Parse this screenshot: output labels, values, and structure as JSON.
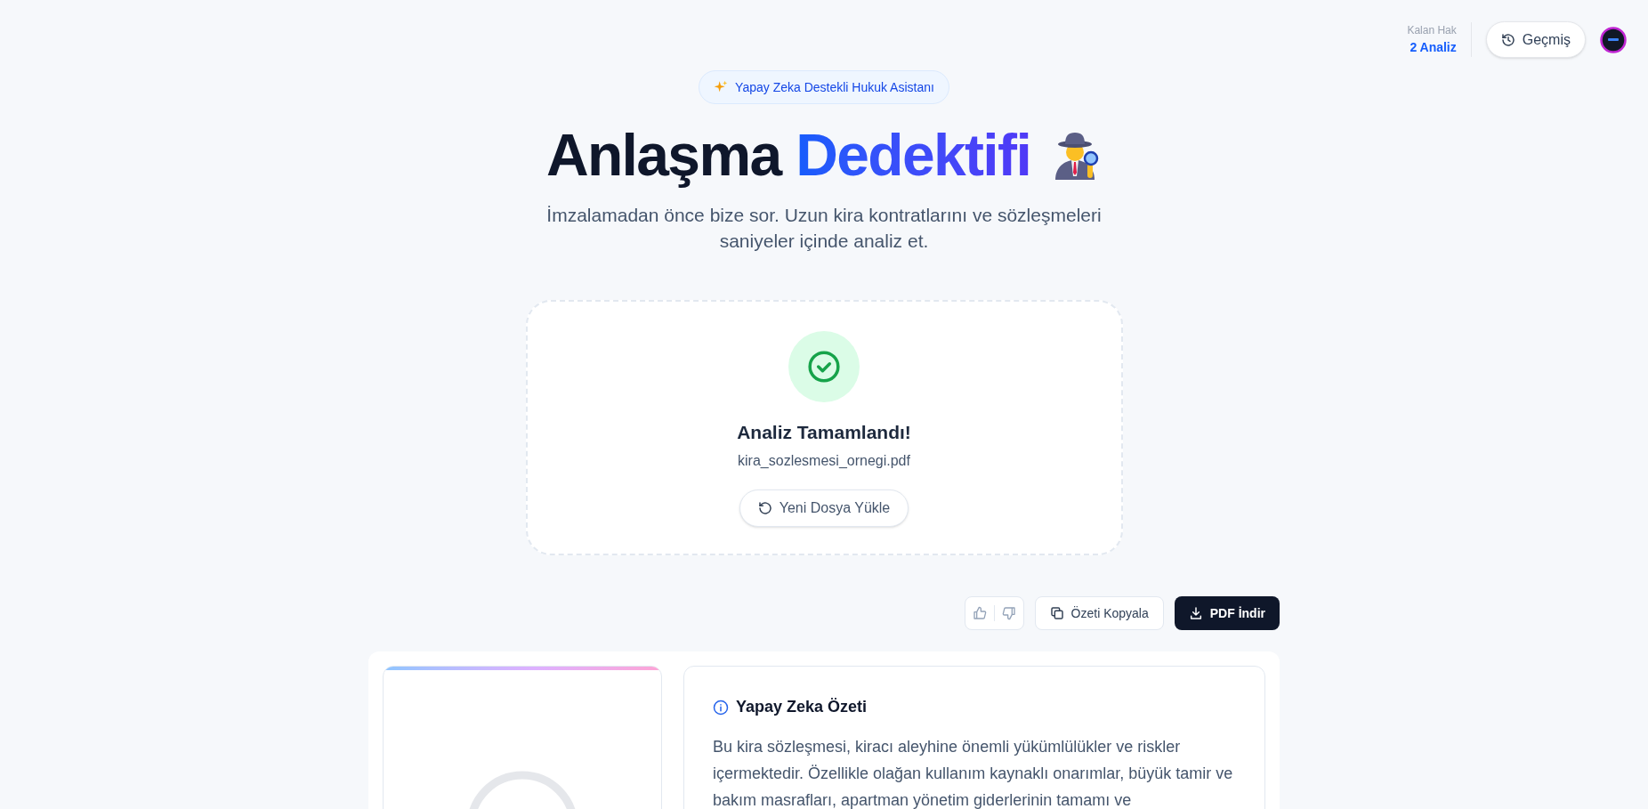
{
  "header": {
    "quota_label": "Kalan Hak",
    "quota_value": "2 Analiz",
    "history_button": "Geçmiş"
  },
  "hero": {
    "badge": "Yapay Zeka Destekli Hukuk Asistanı",
    "title_plain": "Anlaşma",
    "title_accent": "Dedektifi",
    "subtitle": "İmzalamadan önce bize sor. Uzun kira kontratlarını ve sözleşmeleri saniyeler içinde analiz et."
  },
  "upload": {
    "status": "Analiz Tamamlandı!",
    "filename": "kira_sozlesmesi_ornegi.pdf",
    "reset_button": "Yeni Dosya Yükle"
  },
  "actions": {
    "copy_button": "Özeti Kopyala",
    "pdf_button": "PDF İndir"
  },
  "summary": {
    "title": "Yapay Zeka Özeti",
    "text": "Bu kira sözleşmesi, kiracı aleyhine önemli yükümlülükler ve riskler içermektedir. Özellikle olağan kullanım kaynaklı onarımlar, büyük tamir ve bakım masrafları, apartman yönetim giderlerinin tamamı ve"
  }
}
